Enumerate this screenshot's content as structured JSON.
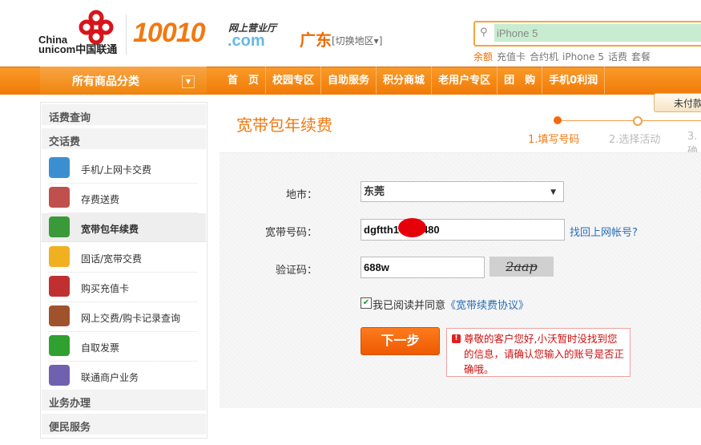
{
  "brand": {
    "logo_china": "China",
    "logo_unicom": "unicom中国联通",
    "site_number": "10010",
    "site_sub": "网上营业厅",
    "site_com": ".com"
  },
  "region": {
    "name": "广东",
    "switch_label": "[切换地区▾]"
  },
  "search": {
    "value": "iPhone 5",
    "icon": "search-icon",
    "hotwords": [
      "余额",
      "充值卡",
      "合约机",
      "iPhone 5",
      "话费",
      "套餐"
    ]
  },
  "nav": {
    "category_label": "所有商品分类",
    "items": [
      "首　页",
      "校园专区",
      "自助服务",
      "积分商城",
      "老用户专区",
      "团　购",
      "手机0利润"
    ],
    "unpaid_label": "未付款"
  },
  "sidebar": {
    "sections": [
      "话费查询",
      "交话费",
      "业务办理",
      "便民服务"
    ],
    "items": [
      {
        "label": "手机/上网卡交费",
        "icon": "mobile-payment-icon",
        "color": "#3b8fd0"
      },
      {
        "label": "存费送费",
        "icon": "coins-icon",
        "color": "#c0504d"
      },
      {
        "label": "宽带包年续费",
        "icon": "globe-icon",
        "color": "#3a9a3a",
        "active": true
      },
      {
        "label": "固话/宽带交费",
        "icon": "telephone-icon",
        "color": "#f0b020"
      },
      {
        "label": "购买充值卡",
        "icon": "recharge-card-icon",
        "color": "#c03030"
      },
      {
        "label": "网上交费/购卡记录查询",
        "icon": "records-search-icon",
        "color": "#a0522d"
      },
      {
        "label": "自取发票",
        "icon": "invoice-icon",
        "color": "#30a030"
      },
      {
        "label": "联通商户业务",
        "icon": "merchant-icon",
        "color": "#7060b0"
      }
    ]
  },
  "main": {
    "title": "宽带包年续费",
    "steps": [
      "1.填写号码",
      "2.选择活动",
      "3.确"
    ],
    "form": {
      "city_label": "地市：",
      "city_value": "东莞",
      "account_label": "宽带号码：",
      "account_value": "dgftth1      5480",
      "recover_link": "找回上网帐号?",
      "captcha_label": "验证码：",
      "captcha_value": "688w",
      "captcha_image_text": "2aap",
      "agree_text": "我已阅读并同意",
      "agreement_link": "《宽带续费协议》",
      "agree_checked": true,
      "next_button": "下一步",
      "error_message": "尊敬的客户您好,小沃暂时没找到您的信息，请确认您输入的账号是否正确哦。"
    }
  },
  "colors": {
    "accent": "#f07a12",
    "nav": "#f68a1a",
    "error": "#cc1010",
    "link": "#2a6fb8"
  }
}
